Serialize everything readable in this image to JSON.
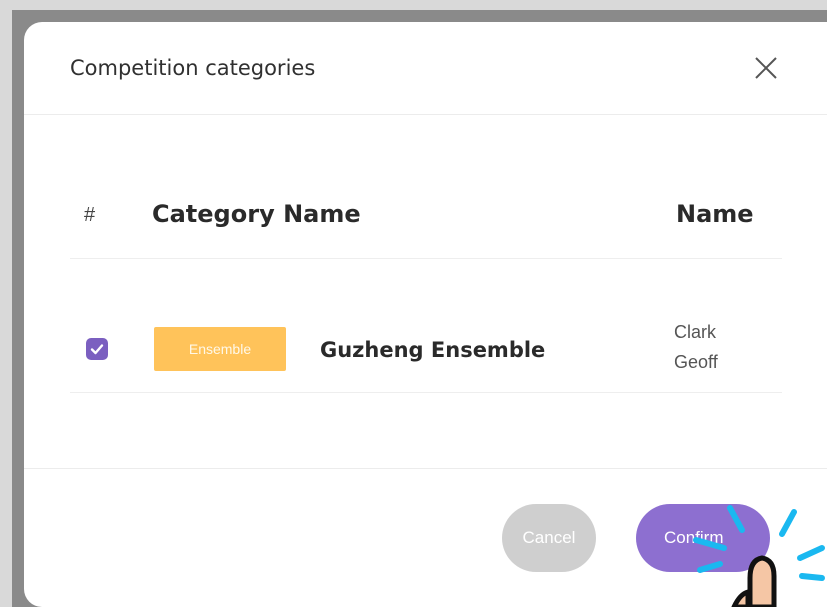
{
  "dialog": {
    "title": "Competition categories"
  },
  "table": {
    "headers": {
      "index": "#",
      "category_name": "Category Name",
      "name": "Name"
    },
    "rows": [
      {
        "checked": true,
        "tag": "Ensemble",
        "category_name": "Guzheng Ensemble",
        "name_line_1": "Clark",
        "name_line_2": "Geoff"
      }
    ]
  },
  "footer": {
    "cancel_label": "Cancel",
    "confirm_label": "Confirm"
  },
  "colors": {
    "checkbox": "#7b5fc0",
    "tag": "#ffc35a",
    "confirm": "#8d6fd0",
    "cancel": "#cfcfcf",
    "cursor_highlight": "#1ab8f0"
  },
  "icons": {
    "close": "close-icon",
    "check": "check-icon",
    "cursor": "hand-cursor-icon"
  }
}
